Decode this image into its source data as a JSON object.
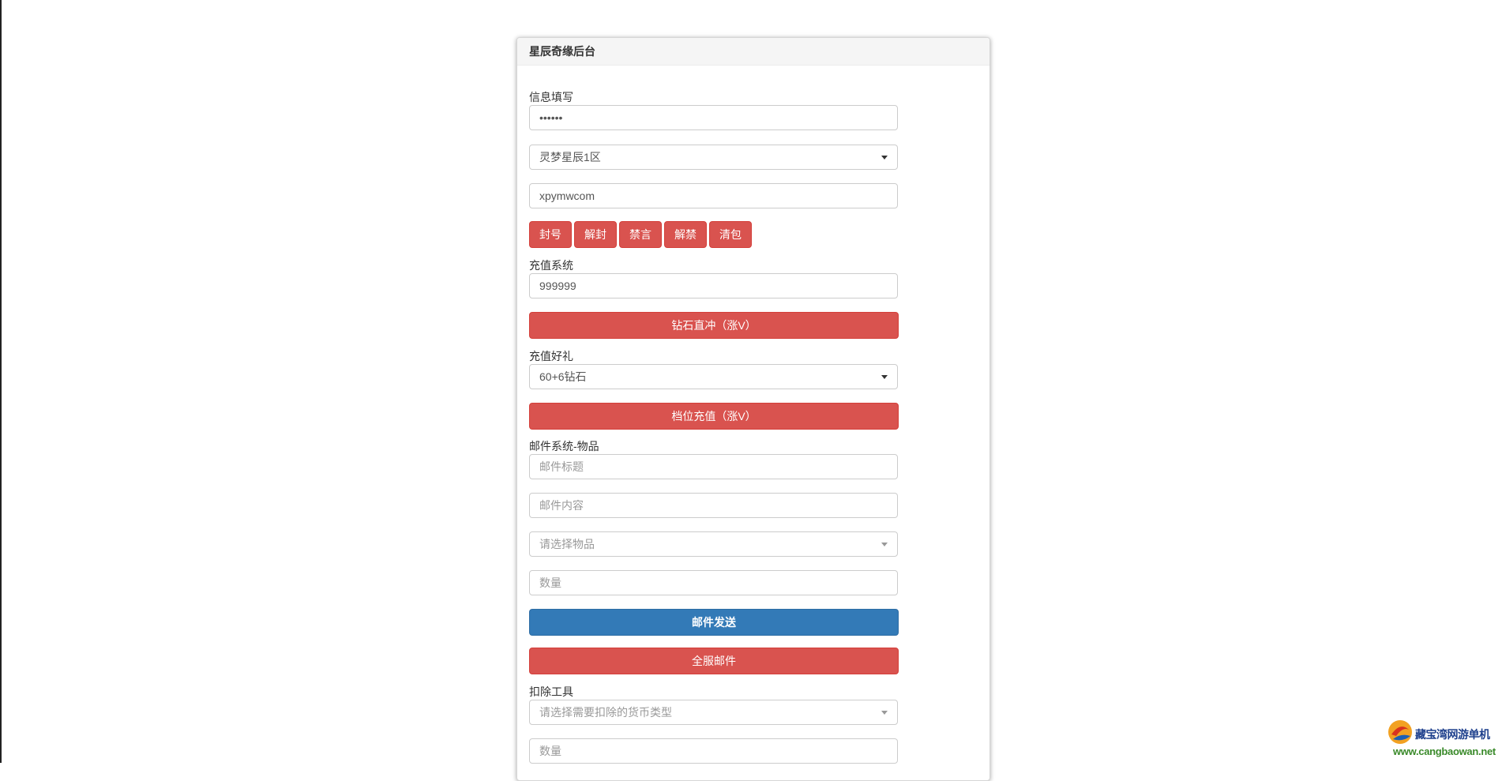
{
  "panel": {
    "title": "星辰奇缘后台"
  },
  "info_section": {
    "label": "信息填写",
    "password_value": "••••••",
    "server_select": "灵梦星辰1区",
    "account_value": "xpymwcom",
    "actions": [
      "封号",
      "解封",
      "禁言",
      "解禁",
      "清包"
    ]
  },
  "recharge_section": {
    "label": "充值系统",
    "amount_value": "999999",
    "button": "钻石直冲（涨V）"
  },
  "gift_section": {
    "label": "充值好礼",
    "gift_select": "60+6钻石",
    "button": "档位充值（涨V）"
  },
  "mail_section": {
    "label": "邮件系统-物品",
    "title_placeholder": "邮件标题",
    "content_placeholder": "邮件内容",
    "item_placeholder": "请选择物品",
    "quantity_placeholder": "数量",
    "send_button": "邮件发送",
    "all_server_button": "全服邮件"
  },
  "deduct_section": {
    "label": "扣除工具",
    "currency_placeholder": "请选择需要扣除的货币类型",
    "quantity_placeholder": "数量"
  },
  "colors": {
    "danger": "#d9534f",
    "primary": "#337ab7"
  },
  "watermark": {
    "text": "藏宝湾网游单机",
    "url": "www.cangbaowan.net"
  }
}
